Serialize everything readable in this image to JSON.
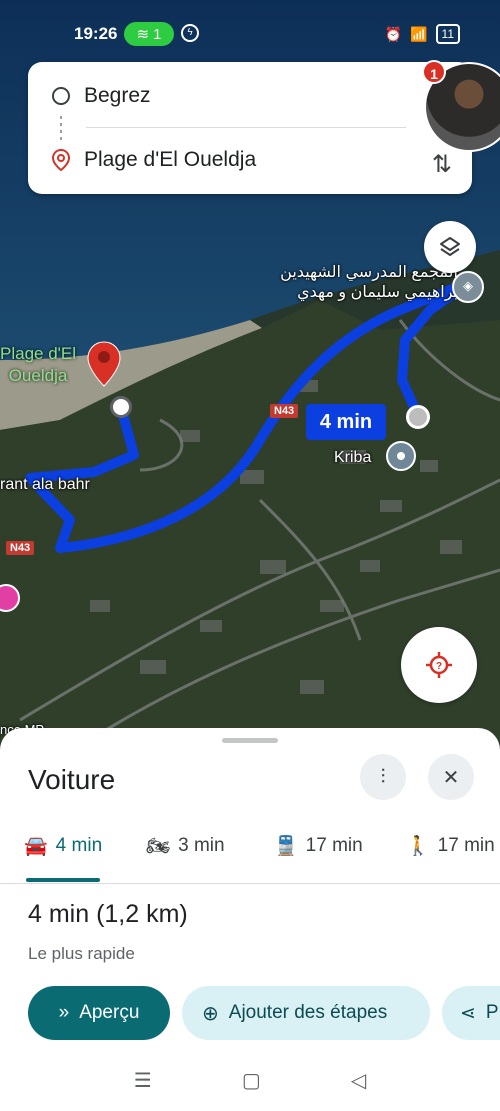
{
  "status": {
    "time": "19:26",
    "wifi_count": "1",
    "signal_text": "4G",
    "battery": "11"
  },
  "search": {
    "origin": "Begrez",
    "destination": "Plage d'El Oueldja"
  },
  "profile": {
    "badge": "1"
  },
  "map": {
    "beach_label": "Plage d'El\nOueldja",
    "restaurant_label": "rant ala bahr",
    "school_label_line1": "المجمع المدرسي الشهيدين",
    "school_label_line2": "براهيمي سليمان و مهدي",
    "town_label": "Kriba",
    "route_chip": "4 min",
    "road_tag_1": "N43",
    "road_tag_2": "N43",
    "corner_text": "nce MP"
  },
  "sheet": {
    "title": "Voiture",
    "modes": [
      {
        "icon": "car-icon",
        "label": "4 min"
      },
      {
        "icon": "motorcycle-icon",
        "label": "3 min"
      },
      {
        "icon": "train-icon",
        "label": "17 min"
      },
      {
        "icon": "walk-icon",
        "label": "17 min"
      }
    ],
    "route_time": "4 min (1,2 km)",
    "route_note": "Le plus rapide",
    "preview_label": "Aperçu",
    "add_stops_label": "Ajouter des étapes",
    "share_label": "P"
  },
  "colors": {
    "route": "#0b3fe0",
    "accent": "#0b6b73",
    "pin": "#d93025"
  }
}
